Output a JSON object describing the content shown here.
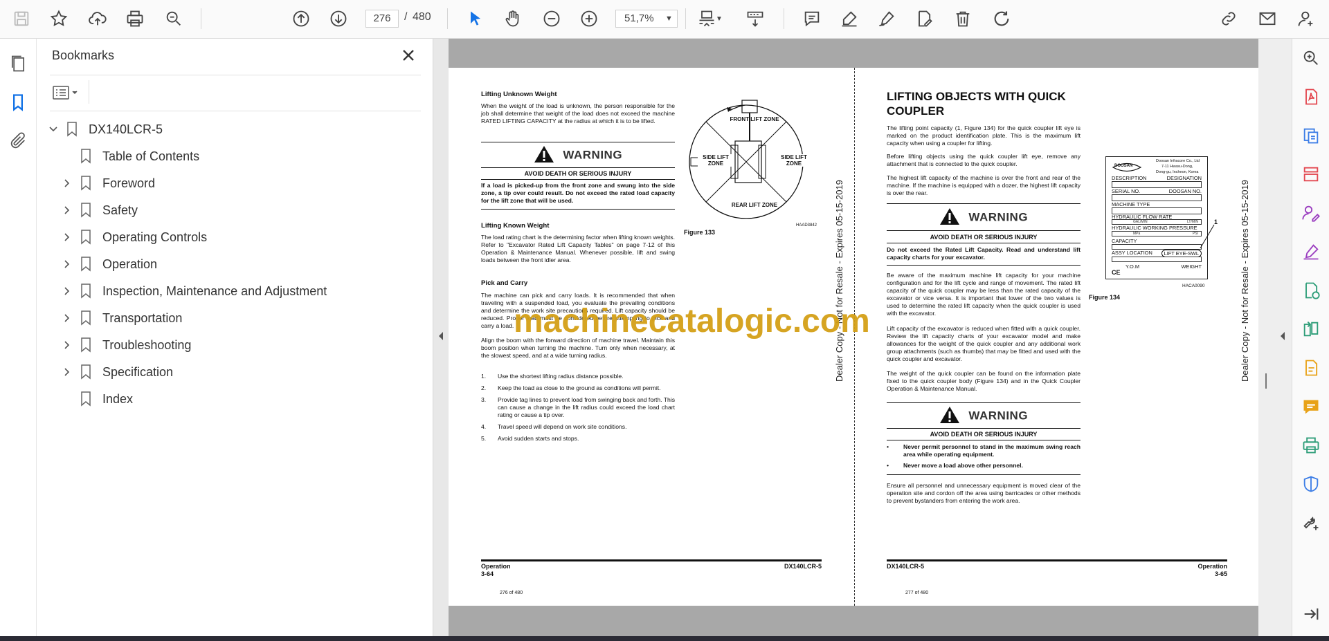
{
  "toolbar": {
    "current_page": "276",
    "page_separator": "/",
    "total_pages": "480",
    "zoom": "51,7%"
  },
  "sidebar": {
    "title": "Bookmarks",
    "bookmarks": [
      {
        "label": "DX140LCR-5",
        "expanded": true
      },
      {
        "label": "Table of Contents"
      },
      {
        "label": "Foreword"
      },
      {
        "label": "Safety"
      },
      {
        "label": "Operating Controls"
      },
      {
        "label": "Operation"
      },
      {
        "label": "Inspection, Maintenance and Adjustment"
      },
      {
        "label": "Transportation"
      },
      {
        "label": "Troubleshooting"
      },
      {
        "label": "Specification"
      },
      {
        "label": "Index"
      }
    ]
  },
  "left_page": {
    "lifting_unknown_title": "Lifting Unknown Weight",
    "lifting_unknown_text": "When the weight of the load is unknown, the person responsible for the job shall determine that weight of the load does not exceed the machine RATED LIFTING CAPACITY at the radius at which it is to be lifted.",
    "warning_title": "WARNING",
    "warning_sub": "AVOID DEATH OR SERIOUS INJURY",
    "warning_text": "If a load is picked-up from the front zone and swung into the side zone, a tip over could result. Do not exceed the rated load capacity for the lift zone that will be used.",
    "lifting_known_title": "Lifting Known Weight",
    "lifting_known_text": "The load rating chart is the determining factor when lifting known weights. Refer to \"Excavator Rated Lift Capacity Tables\" on page 7-12 of this Operation & Maintenance Manual. Whenever possible, lift and swing loads between the front idler area.",
    "pick_carry_title": "Pick and Carry",
    "pick_carry_text": "The machine can pick and carry loads. It is recommended that when traveling with a suspended load, you evaluate the prevailing conditions and determine the work site precautions required. Lift capacity should be reduced. Proper load must be considered before attempting to pick and carry a load.",
    "align_text": "Align the boom with the forward direction of machine travel. Maintain this boom position when turning the machine. Turn only when necessary, at the slowest speed, and at a wide turning radius.",
    "steps": [
      {
        "n": "1.",
        "t": "Use the shortest lifting radius distance possible."
      },
      {
        "n": "2.",
        "t": "Keep the load as close to the ground as conditions will permit."
      },
      {
        "n": "3.",
        "t": "Provide tag lines to prevent load from swinging back and forth. This can cause a change in the lift radius could exceed the load chart rating or cause a tip over."
      },
      {
        "n": "4.",
        "t": "Travel speed will depend on work site conditions."
      },
      {
        "n": "5.",
        "t": "Avoid sudden starts and stops."
      }
    ],
    "figure_label": "Figure 133",
    "figure_code": "HAAD3842",
    "zone_front": "FRONT LIFT ZONE",
    "zone_side_left": "SIDE LIFT ZONE",
    "zone_side_right": "SIDE LIFT ZONE",
    "zone_rear": "REAR LIFT ZONE",
    "footer_left": "Operation",
    "footer_page": "3-64",
    "footer_right": "DX140LCR-5",
    "page_of": "276 of 480",
    "side_text": "Dealer Copy - Not for Resale - Expires 05-15-2019"
  },
  "right_page": {
    "title": "LIFTING OBJECTS WITH QUICK COUPLER",
    "p1": "The lifting point capacity (1, Figure 134) for the quick coupler lift eye is marked on the product identification plate. This is the maximum lift capacity when using a coupler for lifting.",
    "p2": "Before lifting objects using the quick coupler lift eye, remove any attachment that is connected to the quick coupler.",
    "p3": "The highest lift capacity of the machine is over the front and rear of the machine. If the machine is equipped with a dozer, the highest lift capacity is over the rear.",
    "warning_title": "WARNING",
    "warning_sub": "AVOID DEATH OR SERIOUS INJURY",
    "warning_text": "Do not exceed the Rated Lift Capacity. Read and understand lift capacity charts for your excavator.",
    "p4": "Be aware of the maximum machine lift capacity for your machine configuration and for the lift cycle and range of movement. The rated lift capacity of the quick coupler may be less than the rated capacity of the excavator or vice versa. It is important that lower of the two values is used to determine the rated lift capacity when the quick coupler is used with the excavator.",
    "p5": "Lift capacity of the excavator is reduced when fitted with a quick coupler. Review the lift capacity charts of your excavator model and make allowances for the weight of the quick coupler and any additional work group attachments (such as thumbs) that may be fitted and used with the quick coupler and excavator.",
    "p6": "The weight of the quick coupler can be found on the information plate fixed to the quick coupler body (Figure 134) and in the Quick Coupler Operation & Maintenance Manual.",
    "warning2_title": "WARNING",
    "warning2_sub": "AVOID DEATH OR SERIOUS INJURY",
    "bullet1": "Never permit personnel to stand in the maximum swing reach area while operating equipment.",
    "bullet2": "Never move a load above other personnel.",
    "p7": "Ensure all personnel and unnecessary equipment is moved clear of the operation site and cordon off the area using barricades or other methods to prevent bystanders from entering the work area.",
    "figure_label": "Figure 134",
    "figure_code": "HACA0090",
    "callout": "1",
    "plate": {
      "brand": "DOOSAN",
      "maker": "Doosan Infracore Co., Ltd",
      "maker_addr1": "7-11 Hwasu-Dong,",
      "maker_addr2": "Dong-gu, Incheon, Korea",
      "description": "DESCRIPTION",
      "designation": "DESIGNATION",
      "serial": "SERIAL NO.",
      "doosan_no": "DOOSAN NO.",
      "machine_type": "MACHINE TYPE",
      "hyd_flow": "HYDRAULIC FLOW RATE",
      "flow_units_a": "GAL/MIN",
      "flow_units_b": "LT/MIN",
      "hyd_press": "HYDRAULIC WORKING PRESSURE",
      "press_units_a": "MPa",
      "press_units_b": "PSI",
      "capacity": "CAPACITY",
      "assy": "ASSY LOCATION",
      "lift_eye": "LIFT EYE-SWL",
      "yom": "Y.O.M",
      "weight": "WEIGHT",
      "ce": "CE"
    },
    "footer_left": "DX140LCR-5",
    "footer_right": "Operation",
    "footer_page": "3-65",
    "page_of": "277 of 480",
    "side_text": "Dealer Copy - Not for Resale - Expires 05-15-2019"
  },
  "watermark": "machinecatalogic.com"
}
